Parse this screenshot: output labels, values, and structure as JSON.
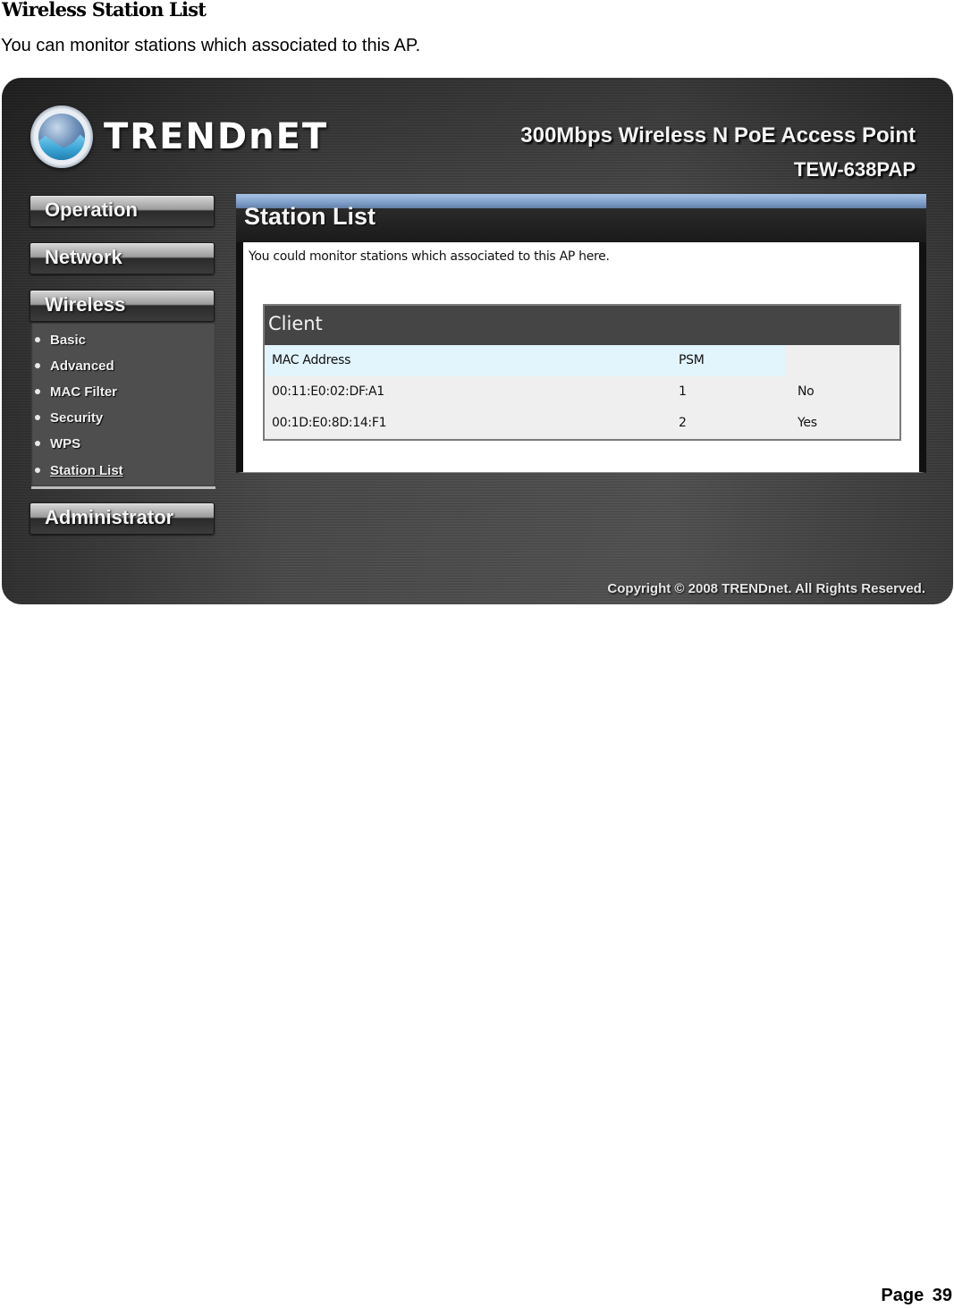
{
  "document": {
    "heading": "Wireless Station List",
    "description": "You can monitor stations which associated to this AP.",
    "page_label": "Page  39"
  },
  "router_ui": {
    "brand": "TRENDnet",
    "brand_display": "TRENDnET",
    "product_title": "300Mbps Wireless N PoE Access Point",
    "model": "TEW-638PAP",
    "nav": {
      "operation": "Operation",
      "network": "Network",
      "wireless": "Wireless",
      "administrator": "Administrator",
      "wireless_submenu": [
        {
          "label": "Basic",
          "active": false
        },
        {
          "label": "Advanced",
          "active": false
        },
        {
          "label": "MAC Filter",
          "active": false
        },
        {
          "label": "Security",
          "active": false
        },
        {
          "label": "WPS",
          "active": false
        },
        {
          "label": "Station List",
          "active": true
        }
      ]
    },
    "panel": {
      "title": "Station List",
      "description": "You could monitor stations which associated to this AP here.",
      "client_table": {
        "title": "Client",
        "columns": [
          "MAC Address",
          "PSM",
          ""
        ],
        "rows": [
          {
            "mac": "00:11:E0:02:DF:A1",
            "index": "1",
            "psm": "No"
          },
          {
            "mac": "00:1D:E0:8D:14:F1",
            "index": "2",
            "psm": "Yes"
          }
        ]
      }
    },
    "copyright": "Copyright © 2008 TRENDnet. All Rights Reserved.",
    "colors": {
      "panel_header_accent": "#7f9fc9",
      "table_header_bg": "#454545",
      "column_header_bg": "#e2f4fc"
    }
  }
}
